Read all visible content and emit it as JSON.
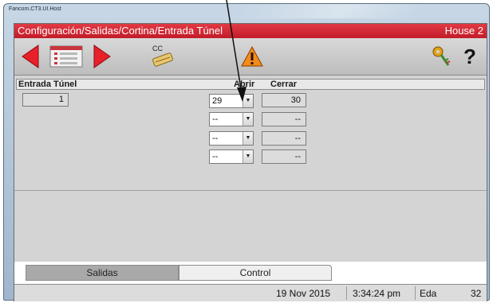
{
  "window": {
    "title": "Fancom.CT3.UI.Host"
  },
  "header": {
    "path": "Configuración/Salidas/Cortina/Entrada Túnel",
    "house": "House 2"
  },
  "toolbar": {
    "cc_label": "CC",
    "help_label": "?"
  },
  "table": {
    "columns": [
      "Entrada Túnel",
      "Abrir",
      "Cerrar"
    ],
    "entry_index": "1",
    "rows": [
      {
        "open": "29",
        "close": "30"
      },
      {
        "open": "--",
        "close": "--"
      },
      {
        "open": "--",
        "close": "--"
      },
      {
        "open": "--",
        "close": "--"
      }
    ]
  },
  "tabs": [
    {
      "label": "Salidas",
      "active": true
    },
    {
      "label": "Control",
      "active": false
    }
  ],
  "status": {
    "date": "19 Nov 2015",
    "time": "3:34:24 pm",
    "label": "Eda",
    "value": "32"
  },
  "colors": {
    "title_red": "#d22a35",
    "arrow_red": "#e8202a"
  },
  "icons": [
    "back-arrow-icon",
    "list-icon",
    "forward-arrow-icon",
    "cc-edit-icon",
    "warning-icon",
    "key-icon",
    "help-icon"
  ]
}
